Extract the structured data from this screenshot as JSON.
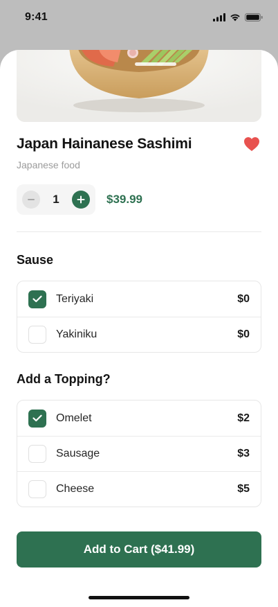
{
  "status_bar": {
    "time": "9:41",
    "icons": [
      "cellular-signal-icon",
      "wifi-icon",
      "battery-icon"
    ]
  },
  "product": {
    "name": "Japan Hainanese Sashimi",
    "category": "Japanese food",
    "image": "sashimi-bowl-photo",
    "favorite": true
  },
  "quantity": {
    "value": "1",
    "decrement_icon": "minus-icon",
    "increment_icon": "plus-icon"
  },
  "price": "$39.99",
  "sauce": {
    "title": "Sause",
    "options": [
      {
        "label": "Teriyaki",
        "price": "$0",
        "checked": true
      },
      {
        "label": "Yakiniku",
        "price": "$0",
        "checked": false
      }
    ]
  },
  "topping": {
    "title": "Add a Topping?",
    "options": [
      {
        "label": "Omelet",
        "price": "$2",
        "checked": true
      },
      {
        "label": "Sausage",
        "price": "$3",
        "checked": false
      },
      {
        "label": "Cheese",
        "price": "$5",
        "checked": false
      }
    ]
  },
  "cta": {
    "label": "Add to Cart ($41.99)"
  },
  "colors": {
    "accent": "#2e7151",
    "heart": "#e8524f",
    "muted_text": "#9b9b9b",
    "overlay_bg": "#bdbdbd"
  }
}
